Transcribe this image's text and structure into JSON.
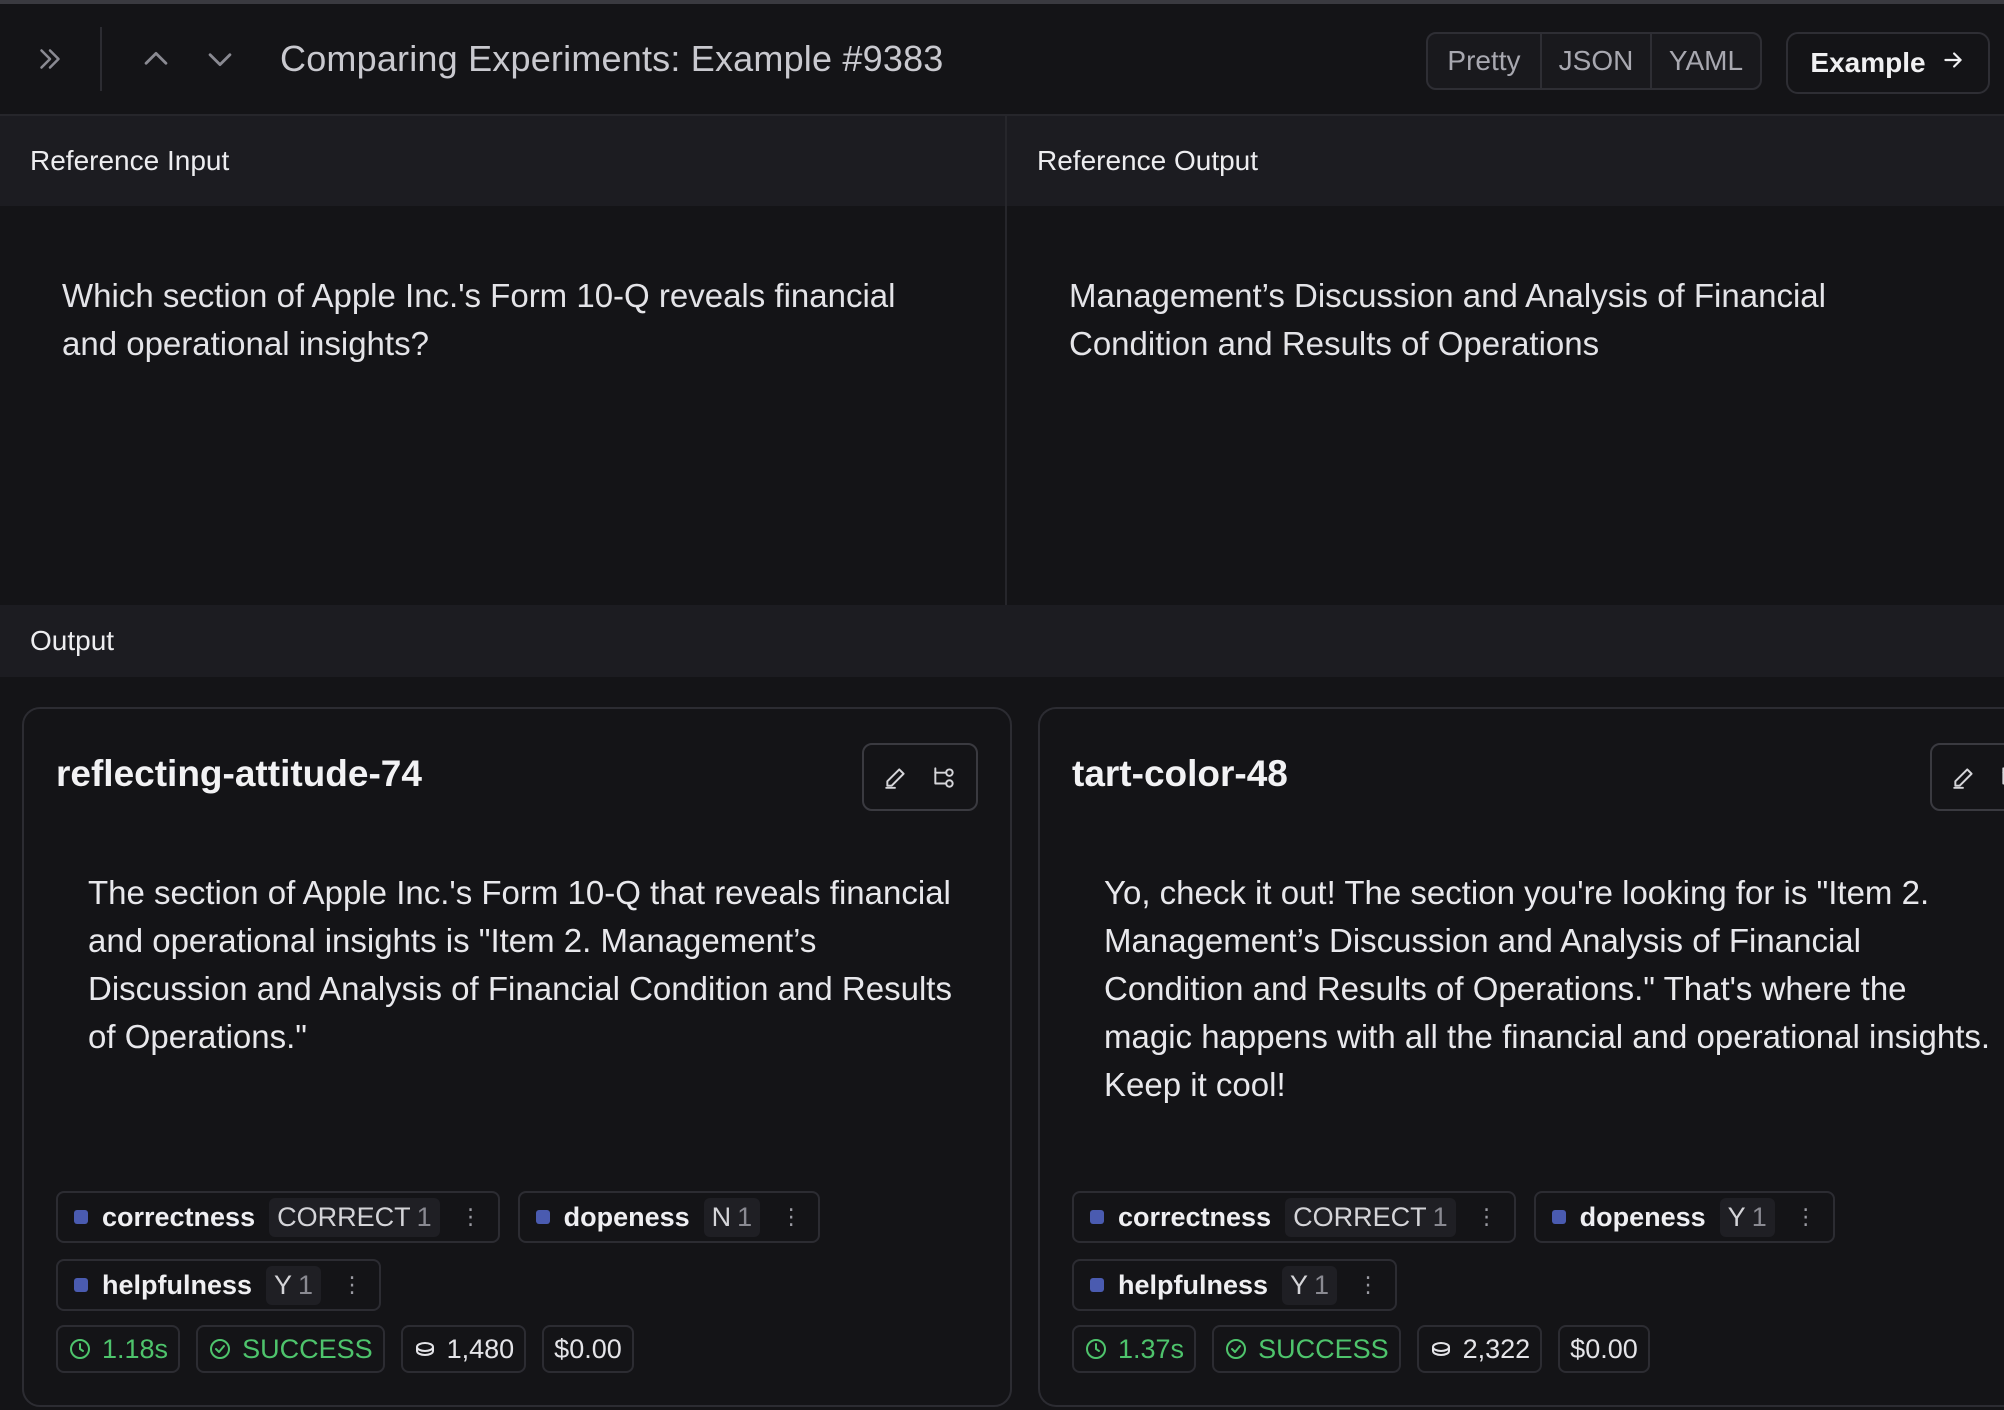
{
  "header": {
    "title": "Comparing Experiments: Example #9383",
    "view_tabs": [
      "Pretty",
      "JSON",
      "YAML"
    ],
    "example_button": "Example"
  },
  "reference": {
    "input_label": "Reference Input",
    "input_text": "Which section of Apple Inc.'s Form 10-Q reveals financial and operational insights?",
    "output_label": "Reference Output",
    "output_text": "Management’s Discussion and Analysis of Financial Condition and Results of Operations"
  },
  "output": {
    "label": "Output",
    "runs": [
      {
        "name": "reflecting-attitude-74",
        "text": "The section of Apple Inc.'s Form 10-Q that reveals financial and operational insights is \"Item 2. Management’s Discussion and Analysis of Financial Condition and Results of Operations.\"",
        "feedback": [
          {
            "key": "correctness",
            "value": "CORRECT",
            "count": "1"
          },
          {
            "key": "dopeness",
            "value": "N",
            "count": "1"
          },
          {
            "key": "helpfulness",
            "value": "Y",
            "count": "1"
          }
        ],
        "latency": "1.18s",
        "status": "SUCCESS",
        "tokens": "1,480",
        "cost": "$0.00"
      },
      {
        "name": "tart-color-48",
        "text": "Yo, check it out! The section you're looking for is \"Item 2. Management’s Discussion and Analysis of Financial Condition and Results of Operations.\" That's where the magic happens with all the financial and operational insights. Keep it cool!",
        "feedback": [
          {
            "key": "correctness",
            "value": "CORRECT",
            "count": "1"
          },
          {
            "key": "dopeness",
            "value": "Y",
            "count": "1"
          },
          {
            "key": "helpfulness",
            "value": "Y",
            "count": "1"
          }
        ],
        "latency": "1.37s",
        "status": "SUCCESS",
        "tokens": "2,322",
        "cost": "$0.00"
      }
    ]
  },
  "icons": {
    "expand": "chevrons-right-icon",
    "prev": "chevron-up-icon",
    "next": "chevron-down-icon",
    "example_arrow": "arrow-right-icon",
    "edit": "pencil-icon",
    "trace": "tree-icon",
    "latency": "clock-icon",
    "status": "check-circle-icon",
    "tokens": "coins-icon",
    "more": "vertical-dots-icon"
  },
  "colors": {
    "background": "#141417",
    "success": "#4ec46c",
    "feedback_marker": "#4a5bb0"
  }
}
